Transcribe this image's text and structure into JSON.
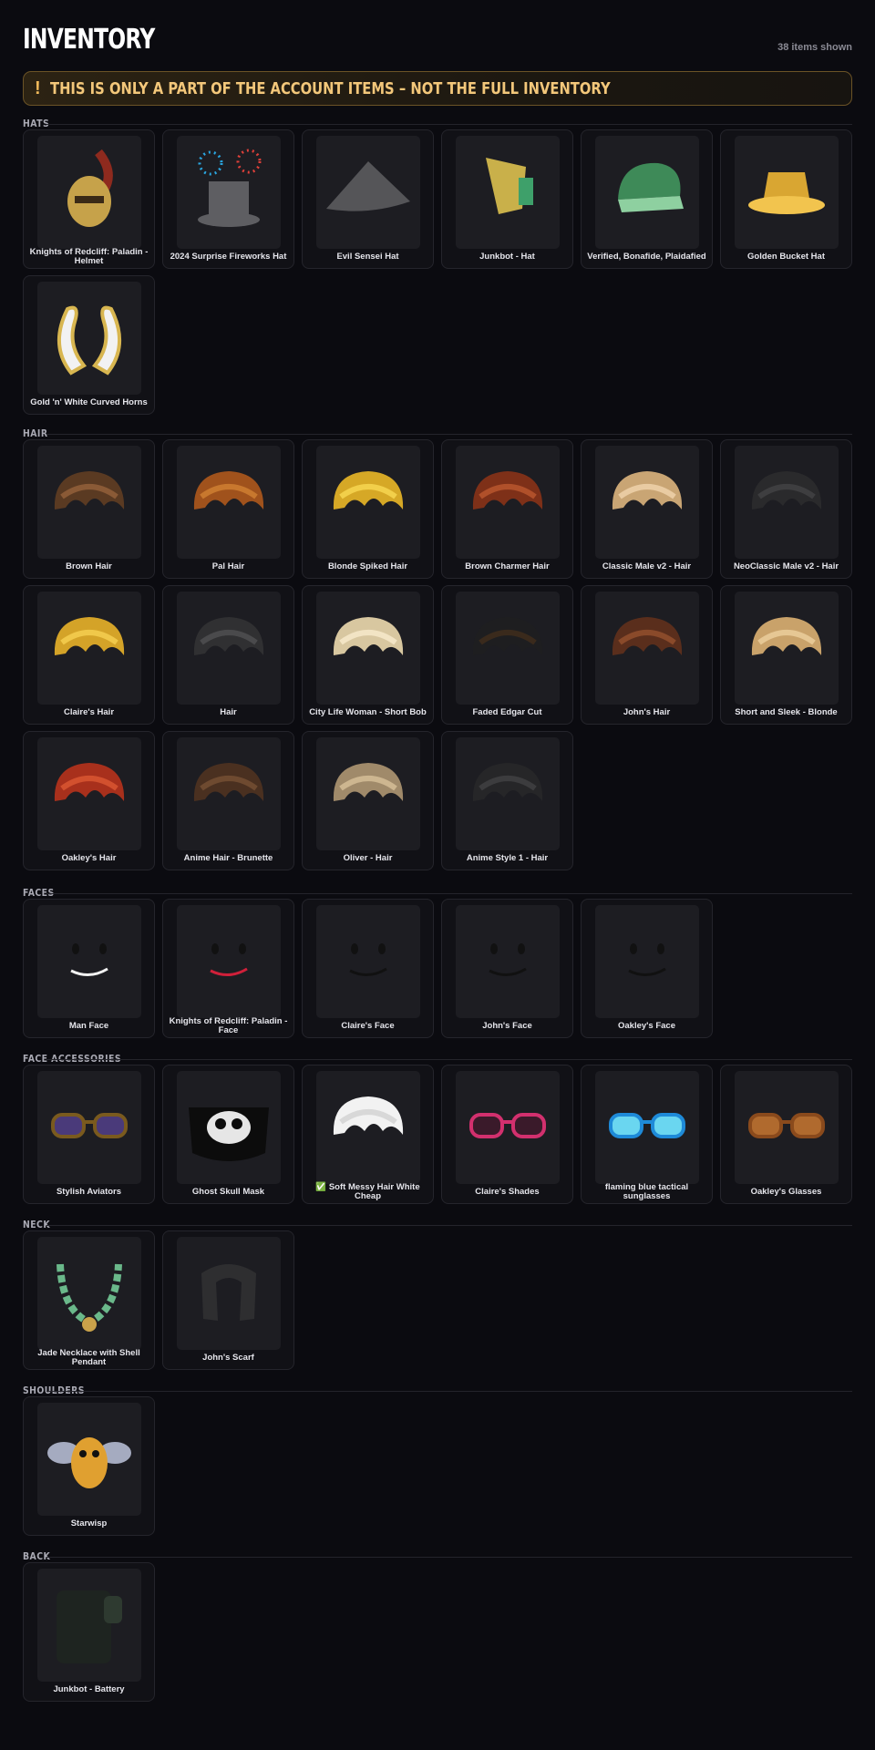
{
  "header": {
    "title": "INVENTORY",
    "count": "38 items shown"
  },
  "warning": {
    "icon": "!",
    "text": "THIS IS ONLY A PART OF THE ACCOUNT ITEMS – NOT THE FULL INVENTORY"
  },
  "sections": [
    {
      "title": "HATS",
      "items": [
        {
          "name": "Knights of Redcliff: Paladin - Helmet",
          "icon": "helmet-icon"
        },
        {
          "name": "2024 Surprise Fireworks Hat",
          "icon": "top-hat-icon"
        },
        {
          "name": "Evil Sensei Hat",
          "icon": "cone-hat-icon"
        },
        {
          "name": "Junkbot - Hat",
          "icon": "robot-hat-icon"
        },
        {
          "name": "Verified, Bonafide, Plaidafied",
          "icon": "plaid-cap-icon"
        },
        {
          "name": "Golden Bucket Hat",
          "icon": "bucket-hat-icon"
        },
        {
          "name": "Gold 'n' White Curved Horns",
          "icon": "horns-icon"
        }
      ]
    },
    {
      "title": "HAIR",
      "items": [
        {
          "name": "Brown Hair",
          "icon": "hair-icon"
        },
        {
          "name": "Pal Hair",
          "icon": "hair-icon"
        },
        {
          "name": "Blonde Spiked Hair",
          "icon": "hair-icon"
        },
        {
          "name": "Brown Charmer Hair",
          "icon": "hair-icon"
        },
        {
          "name": "Classic Male v2 - Hair",
          "icon": "hair-icon"
        },
        {
          "name": "NeoClassic Male v2 - Hair",
          "icon": "hair-icon"
        },
        {
          "name": "Claire's Hair",
          "icon": "hair-icon"
        },
        {
          "name": "Hair",
          "icon": "hair-icon"
        },
        {
          "name": "City Life Woman - Short Bob",
          "icon": "hair-icon"
        },
        {
          "name": "Faded Edgar Cut",
          "icon": "hair-icon"
        },
        {
          "name": "John's Hair",
          "icon": "hair-icon"
        },
        {
          "name": "Short and Sleek - Blonde",
          "icon": "hair-icon"
        },
        {
          "name": "Oakley's Hair",
          "icon": "hair-icon"
        },
        {
          "name": "Anime Hair - Brunette",
          "icon": "hair-icon"
        },
        {
          "name": "Oliver - Hair",
          "icon": "hair-icon"
        },
        {
          "name": "Anime Style 1 - Hair",
          "icon": "hair-icon"
        }
      ]
    },
    {
      "title": "FACES",
      "items": [
        {
          "name": "Man Face",
          "icon": "face-icon"
        },
        {
          "name": "Knights of Redcliff: Paladin - Face",
          "icon": "face-icon"
        },
        {
          "name": "Claire's Face",
          "icon": "face-icon"
        },
        {
          "name": "John's Face",
          "icon": "face-icon"
        },
        {
          "name": "Oakley's Face",
          "icon": "face-icon"
        }
      ]
    },
    {
      "title": "FACE ACCESSORIES",
      "items": [
        {
          "name": "Stylish Aviators",
          "icon": "aviators-icon"
        },
        {
          "name": "Ghost Skull Mask",
          "icon": "skull-mask-icon"
        },
        {
          "name": "✅ Soft Messy Hair White Cheap",
          "icon": "hair-icon"
        },
        {
          "name": "Claire's Shades",
          "icon": "sunglasses-icon"
        },
        {
          "name": "flaming blue tactical sunglasses",
          "icon": "tactical-glasses-icon"
        },
        {
          "name": "Oakley's Glasses",
          "icon": "glasses-icon"
        }
      ]
    },
    {
      "title": "NECK",
      "items": [
        {
          "name": "Jade Necklace with Shell Pendant",
          "icon": "necklace-icon"
        },
        {
          "name": "John's Scarf",
          "icon": "scarf-icon"
        }
      ]
    },
    {
      "title": "SHOULDERS",
      "items": [
        {
          "name": "Starwisp",
          "icon": "bee-pet-icon"
        }
      ]
    },
    {
      "title": "BACK",
      "items": [
        {
          "name": "Junkbot - Battery",
          "icon": "battery-icon"
        }
      ]
    }
  ]
}
